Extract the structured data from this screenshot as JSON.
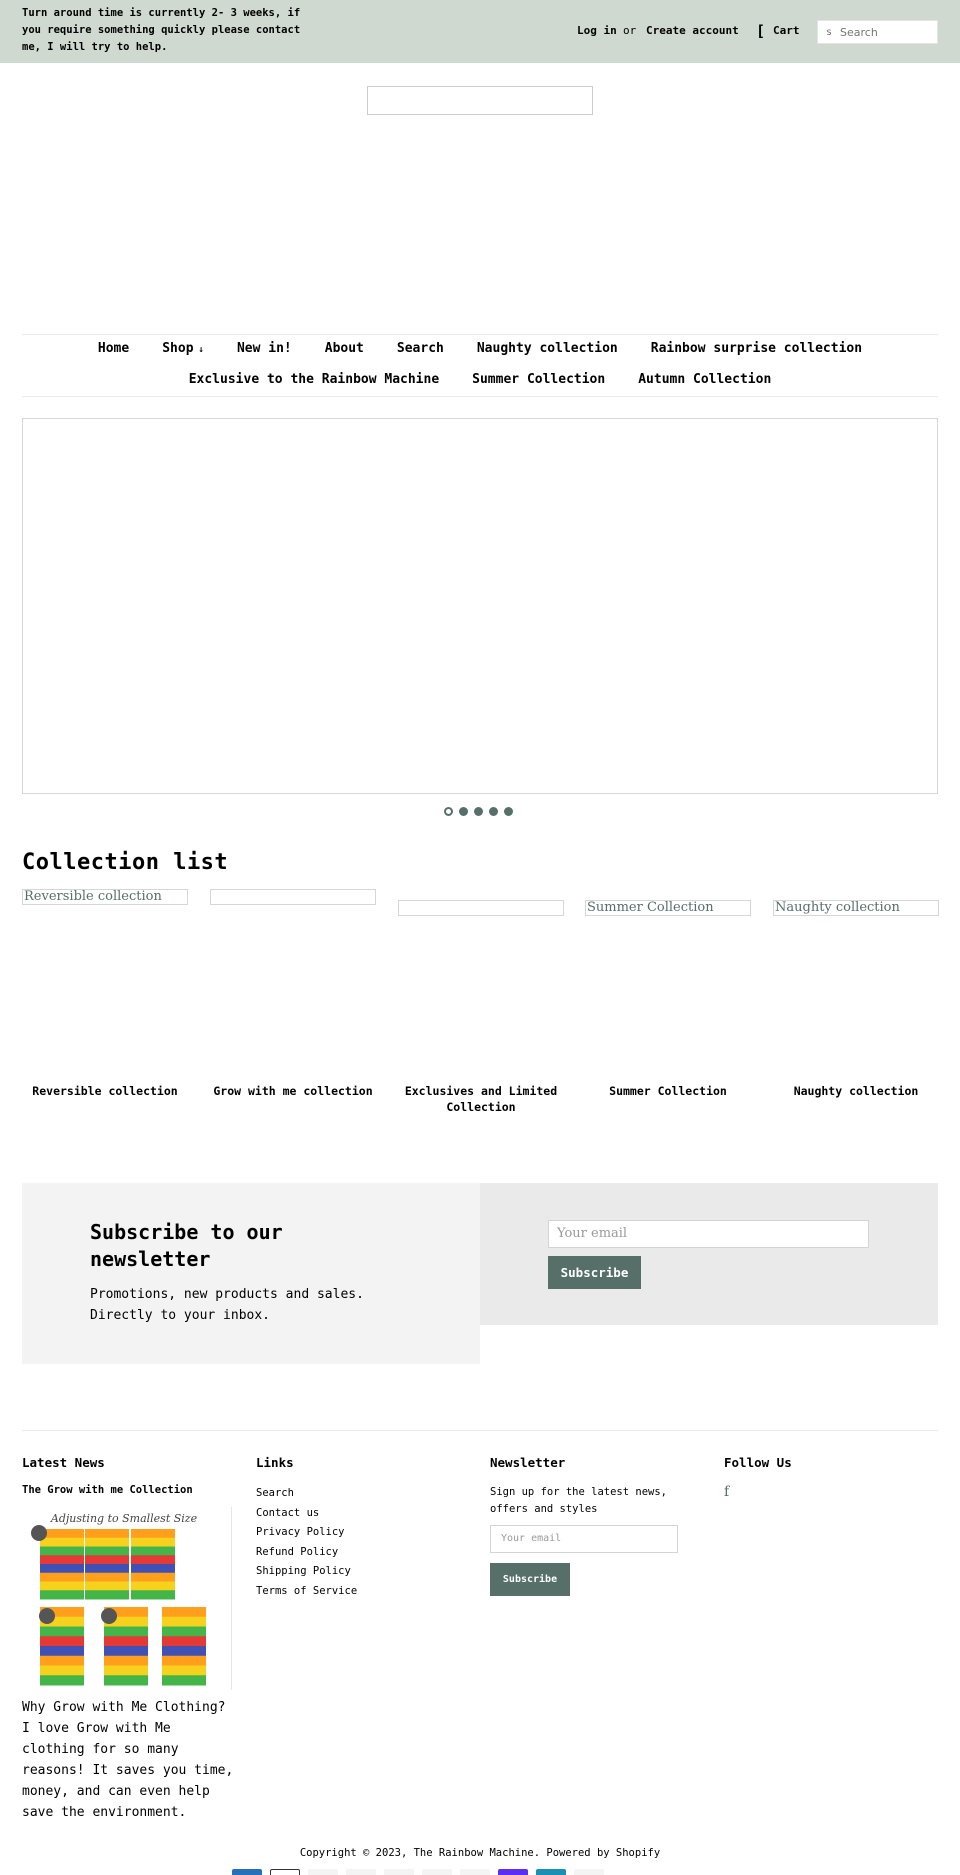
{
  "announcement": "Turn around time is currently 2- 3 weeks, if you require something quickly please contact me, I will try to help.",
  "account": {
    "login": "Log in",
    "or": "or",
    "create": "Create account"
  },
  "cart": {
    "icon": "cart-icon",
    "label": "Cart"
  },
  "search": {
    "placeholder": "Search",
    "icon": "search-icon"
  },
  "nav": {
    "row1": [
      "Home",
      "Shop",
      "New in!",
      "About",
      "Search",
      "Naughty collection",
      "Rainbow surprise collection"
    ],
    "row2": [
      "Exclusive to the Rainbow Machine",
      "Summer Collection",
      "Autumn Collection"
    ],
    "shop_chevron": "chevron-down-icon"
  },
  "slideshow": {
    "dots": 5,
    "active": 1
  },
  "collections": {
    "title": "Collection list",
    "items": [
      {
        "image_alt": "Reversible collection",
        "title": "Reversible collection"
      },
      {
        "image_alt": "",
        "title": "Grow with me collection"
      },
      {
        "image_alt": "",
        "title": "Exclusives and Limited Collection"
      },
      {
        "image_alt": "Summer Collection",
        "title": "Summer Collection"
      },
      {
        "image_alt": "Naughty collection",
        "title": "Naughty collection"
      }
    ]
  },
  "newsletter": {
    "heading": "Subscribe to our newsletter",
    "subtext": "Promotions, new products and sales. Directly to your inbox.",
    "placeholder": "Your email",
    "button": "Subscribe"
  },
  "footer": {
    "latest_news": {
      "heading": "Latest News",
      "post_title": "The Grow with me Collection",
      "image_caption": "Adjusting to Smallest Size",
      "excerpt": "Why Grow with Me Clothing? I love Grow with Me clothing for so many reasons! It saves you time, money, and can even help save the environment."
    },
    "links": {
      "heading": "Links",
      "items": [
        "Search",
        "Contact us",
        "Privacy Policy",
        "Refund Policy",
        "Shipping Policy",
        "Terms of Service"
      ]
    },
    "newsletter": {
      "heading": "Newsletter",
      "text": "Sign up for the latest news, offers and styles",
      "placeholder": "Your email",
      "button": "Subscribe"
    },
    "follow": {
      "heading": "Follow Us",
      "icon": "facebook-icon",
      "glyph": "f"
    },
    "copyright": "Copyright © 2023, The Rainbow Machine. Powered by Shopify"
  },
  "colors": {
    "topbar": "#cfd9d0",
    "accent": "#566f69",
    "panel_light": "#f3f3f3",
    "panel_mid": "#eaeaea"
  }
}
